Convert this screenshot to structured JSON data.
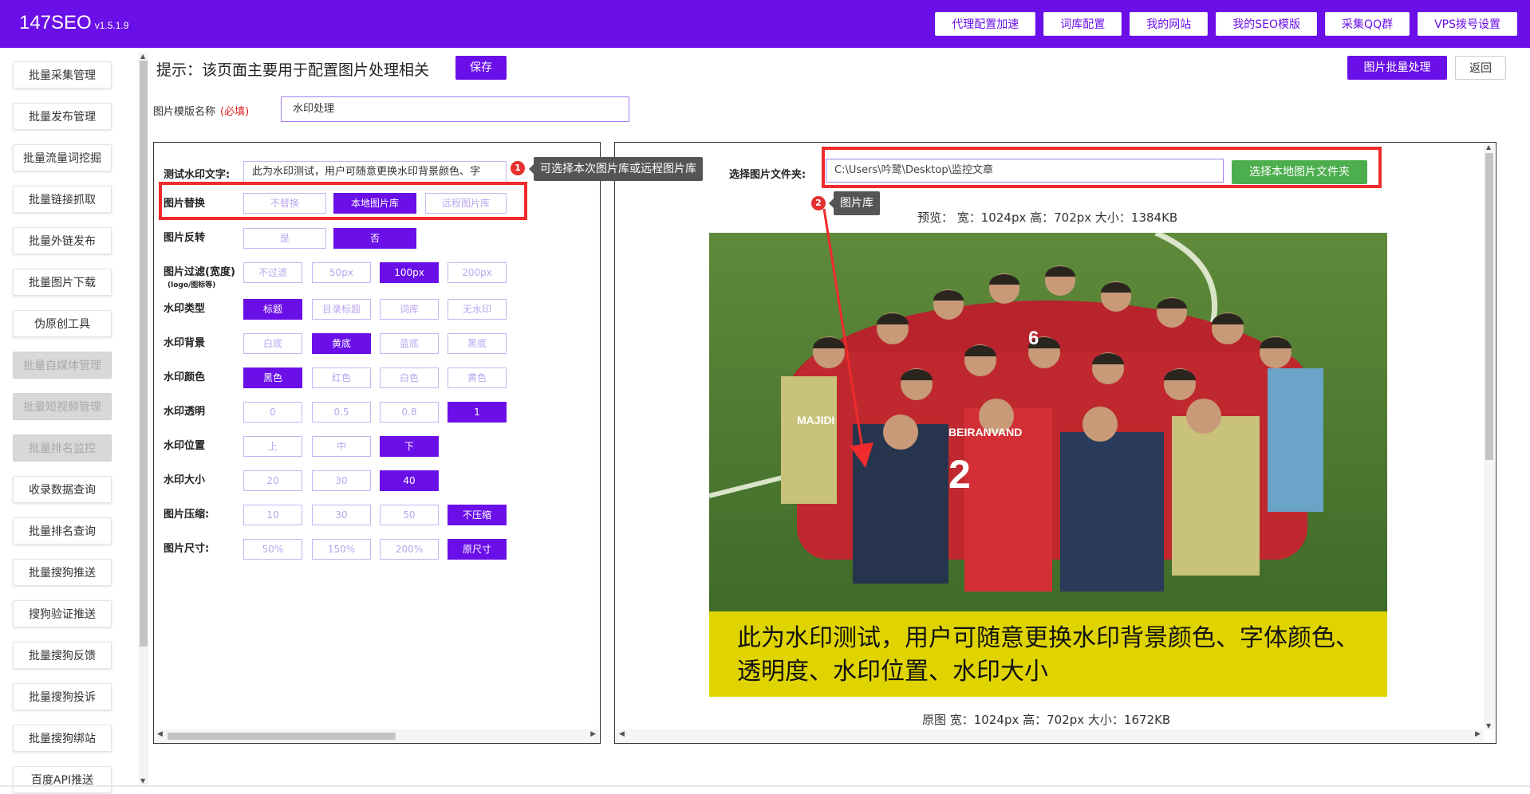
{
  "app": {
    "name": "147SEO",
    "version": "v1.5.1.9"
  },
  "topnav": [
    "代理配置加速",
    "词库配置",
    "我的网站",
    "我的SEO模版",
    "采集QQ群",
    "VPS拨号设置"
  ],
  "sidebar": {
    "items": [
      {
        "label": "批量采集管理",
        "disabled": false
      },
      {
        "label": "批量发布管理",
        "disabled": false
      },
      {
        "label": "批量流量词挖掘",
        "disabled": false
      },
      {
        "label": "批量链接抓取",
        "disabled": false
      },
      {
        "label": "批量外链发布",
        "disabled": false
      },
      {
        "label": "批量图片下载",
        "disabled": false
      },
      {
        "label": "伪原创工具",
        "disabled": false
      },
      {
        "label": "批量自媒体管理",
        "disabled": true
      },
      {
        "label": "批量短视频管理",
        "disabled": true
      },
      {
        "label": "批量排名监控",
        "disabled": true
      },
      {
        "label": "收录数据查询",
        "disabled": false
      },
      {
        "label": "批量排名查询",
        "disabled": false
      },
      {
        "label": "批量搜狗推送",
        "disabled": false
      },
      {
        "label": "搜狗验证推送",
        "disabled": false
      },
      {
        "label": "批量搜狗反馈",
        "disabled": false
      },
      {
        "label": "批量搜狗投诉",
        "disabled": false
      },
      {
        "label": "批量搜狗绑站",
        "disabled": false
      },
      {
        "label": "百度API推送",
        "disabled": false
      }
    ]
  },
  "header": {
    "tip": "提示：该页面主要用于配置图片处理相关",
    "save_label": "保存",
    "batch_label": "图片批量处理",
    "back_label": "返回"
  },
  "template": {
    "label": "图片模版名称",
    "required": "(必填)",
    "value": "水印处理"
  },
  "settings": {
    "wm_text_label": "测试水印文字:",
    "wm_text_value": "此为水印测试，用户可随意更换水印背景颜色、字",
    "rows": [
      {
        "key": "replace",
        "label": "图片替换",
        "options": [
          "不替换",
          "本地图片库",
          "远程图片库"
        ],
        "selected": 1
      },
      {
        "key": "flip",
        "label": "图片反转",
        "options": [
          "是",
          "否"
        ],
        "selected": 1
      },
      {
        "key": "filter",
        "label": "图片过滤(宽度)",
        "sub": "(logo/图标等)",
        "options": [
          "不过滤",
          "50px",
          "100px",
          "200px"
        ],
        "selected": 2
      },
      {
        "key": "wm_type",
        "label": "水印类型",
        "options": [
          "标题",
          "目录标题",
          "词库",
          "无水印"
        ],
        "selected": 0
      },
      {
        "key": "wm_bg",
        "label": "水印背景",
        "options": [
          "白底",
          "黄底",
          "蓝底",
          "黑底"
        ],
        "selected": 1
      },
      {
        "key": "wm_color",
        "label": "水印颜色",
        "options": [
          "黑色",
          "红色",
          "白色",
          "黄色"
        ],
        "selected": 0
      },
      {
        "key": "wm_opacity",
        "label": "水印透明",
        "options": [
          "0",
          "0.5",
          "0.8",
          "1"
        ],
        "selected": 3
      },
      {
        "key": "wm_pos",
        "label": "水印位置",
        "options": [
          "上",
          "中",
          "下"
        ],
        "selected": 2
      },
      {
        "key": "wm_size",
        "label": "水印大小",
        "options": [
          "20",
          "30",
          "40"
        ],
        "selected": 2
      },
      {
        "key": "compress",
        "label": "图片压缩:",
        "options": [
          "10",
          "30",
          "50",
          "不压缩"
        ],
        "selected": 3
      },
      {
        "key": "size",
        "label": "图片尺寸:",
        "options": [
          "50%",
          "150%",
          "200%",
          "原尺寸"
        ],
        "selected": 3
      }
    ]
  },
  "folder": {
    "label": "选择图片文件夹:",
    "value": "C:\\Users\\吟鹭\\Desktop\\监控文章",
    "button": "选择本地图片文件夹"
  },
  "preview": {
    "info": "预览： 宽：1024px 高：702px 大小：1384KB",
    "watermark": "此为水印测试，用户可随意更换水印背景颜色、字体颜色、透明度、水印位置、水印大小",
    "original_info": "原图 宽：1024px 高：702px 大小：1672KB"
  },
  "annotations": {
    "one_num": "1",
    "one_text": "可选择本次图片库或远程图片库",
    "two_num": "2",
    "two_text": "图片库"
  },
  "colors": {
    "primary": "#6a0fe8",
    "green": "#4cae4c",
    "watermark_bg": "#e0d400",
    "annotation": "#ef2b2b"
  }
}
